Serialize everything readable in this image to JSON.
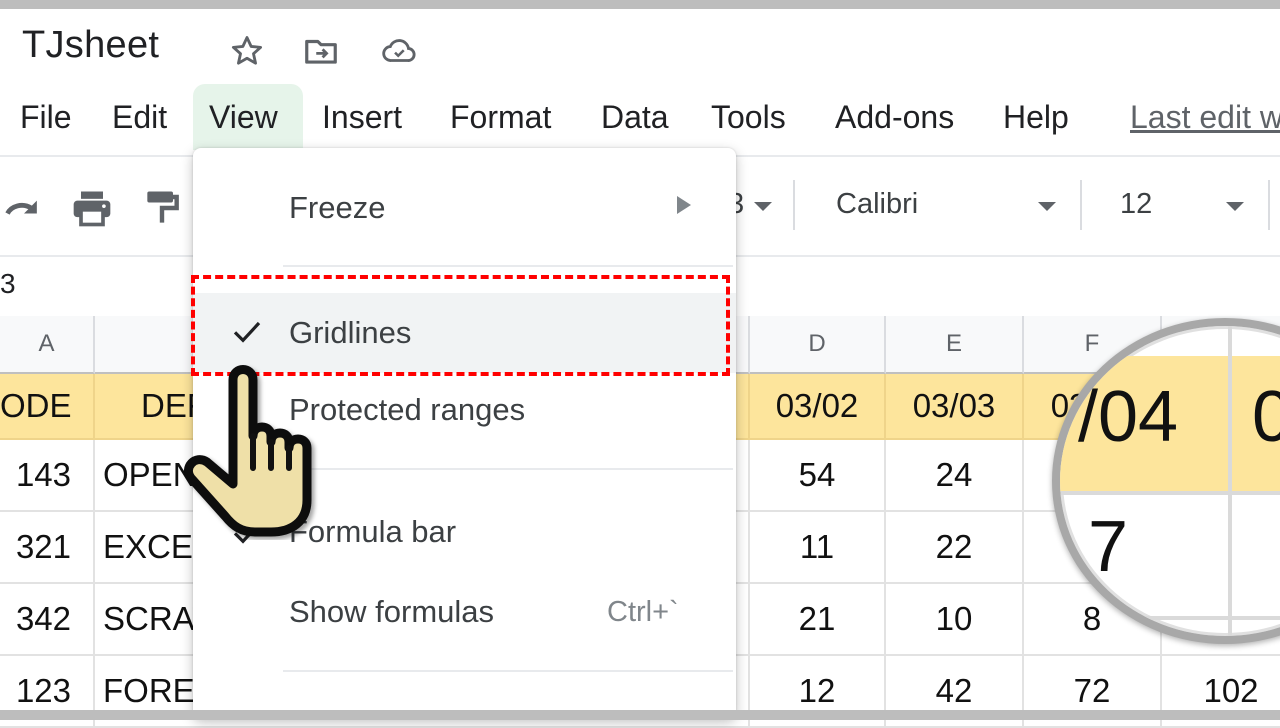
{
  "app": {
    "doc_title": "TJsheet",
    "title_icons": [
      "star-icon",
      "move-to-folder-icon",
      "cloud-saved-icon"
    ]
  },
  "menubar": {
    "items": [
      {
        "label": "File"
      },
      {
        "label": "Edit"
      },
      {
        "label": "View",
        "active": true
      },
      {
        "label": "Insert"
      },
      {
        "label": "Format"
      },
      {
        "label": "Data"
      },
      {
        "label": "Tools"
      },
      {
        "label": "Add-ons"
      },
      {
        "label": "Help"
      }
    ],
    "last_edit": "Last edit w"
  },
  "toolbar": {
    "icons": [
      "redo-icon",
      "print-icon",
      "paint-format-icon"
    ],
    "partial_dropdown_text": "3",
    "font_family": "Calibri",
    "font_size": "12"
  },
  "formula_bar": {
    "cell_ref": "3"
  },
  "view_menu": {
    "items": [
      {
        "label": "Freeze",
        "has_submenu": true,
        "checked": false
      },
      {
        "label": "Gridlines",
        "checked": true,
        "highlighted": true
      },
      {
        "label": "Protected ranges",
        "checked": true
      },
      {
        "label": "Formula bar",
        "checked": true
      },
      {
        "label": "Show formulas",
        "shortcut": "Ctrl+`",
        "checked": false
      }
    ]
  },
  "sheet": {
    "columns": [
      "A",
      "",
      "D",
      "E",
      "F",
      ""
    ],
    "header_row": [
      "ODE",
      "DEF",
      "03/02",
      "03/03",
      "03/04",
      ""
    ],
    "rows": [
      {
        "code": "143",
        "desc": "OPEN",
        "d": "54",
        "e": "24",
        "f": "7",
        "g": ""
      },
      {
        "code": "321",
        "desc": "EXCES",
        "d": "11",
        "e": "22",
        "f": "",
        "g": ""
      },
      {
        "code": "342",
        "desc": "SCRAT",
        "d": "21",
        "e": "10",
        "f": "8",
        "g": ""
      },
      {
        "code": "123",
        "desc": "FORE",
        "d": "12",
        "e": "42",
        "f": "72",
        "g": "102"
      }
    ]
  },
  "magnifier": {
    "header_text": "/04",
    "header_next": "0",
    "cell_text": "7"
  },
  "colors": {
    "highlight_border": "#ff0000",
    "header_fill": "#fde59c",
    "active_menu_bg": "#e6f4ea"
  }
}
